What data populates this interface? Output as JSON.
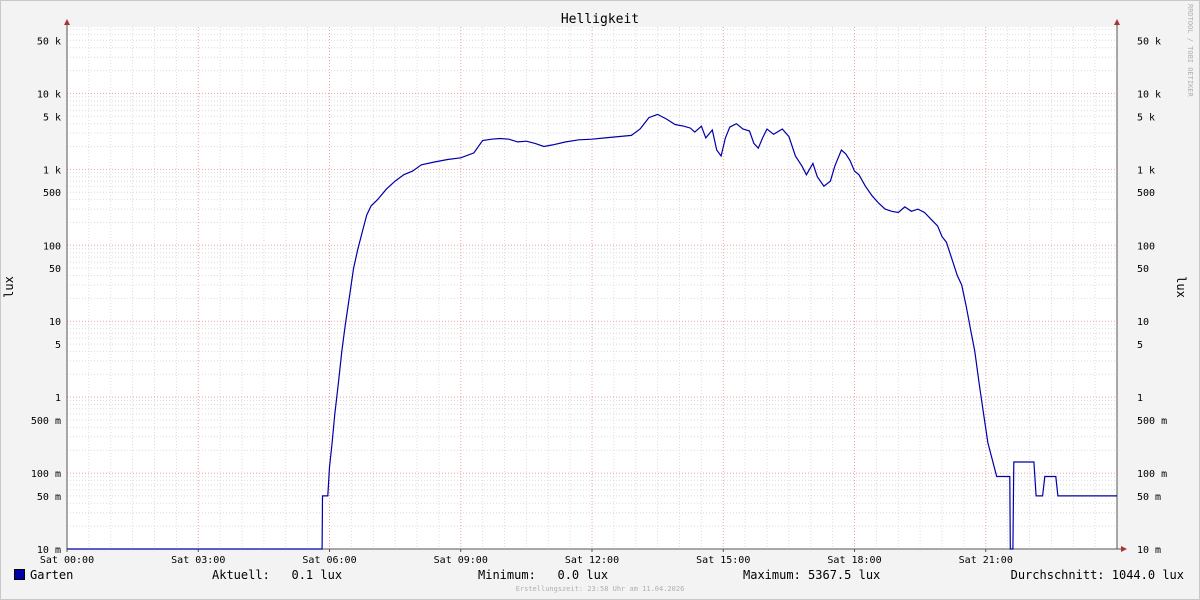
{
  "chart_data": {
    "type": "line",
    "title": "Helligkeit",
    "ylabel": "lux",
    "yscale": "log",
    "ylim": [
      0.01,
      75000
    ],
    "xlim": [
      0,
      24
    ],
    "grid": true,
    "x_tick_labels": [
      {
        "x": 0,
        "label": "Sat 00:00"
      },
      {
        "x": 3,
        "label": "Sat 03:00"
      },
      {
        "x": 6,
        "label": "Sat 06:00"
      },
      {
        "x": 9,
        "label": "Sat 09:00"
      },
      {
        "x": 12,
        "label": "Sat 12:00"
      },
      {
        "x": 15,
        "label": "Sat 15:00"
      },
      {
        "x": 18,
        "label": "Sat 18:00"
      },
      {
        "x": 21,
        "label": "Sat 21:00"
      }
    ],
    "y_tick_labels": [
      {
        "y": 50000,
        "label": "50 k"
      },
      {
        "y": 10000,
        "label": "10 k"
      },
      {
        "y": 5000,
        "label": "5 k"
      },
      {
        "y": 1000,
        "label": "1 k"
      },
      {
        "y": 500,
        "label": "500"
      },
      {
        "y": 100,
        "label": "100"
      },
      {
        "y": 50,
        "label": "50"
      },
      {
        "y": 10,
        "label": "10"
      },
      {
        "y": 5,
        "label": "5"
      },
      {
        "y": 1,
        "label": "1"
      },
      {
        "y": 0.5,
        "label": "500 m"
      },
      {
        "y": 0.1,
        "label": "100 m"
      },
      {
        "y": 0.05,
        "label": "50 m"
      },
      {
        "y": 0.01,
        "label": "10 m"
      }
    ],
    "series": [
      {
        "name": "Garten",
        "color": "#0000aa",
        "points": [
          [
            0,
            0.01
          ],
          [
            5.83,
            0.01
          ],
          [
            5.84,
            0.05
          ],
          [
            5.96,
            0.05
          ],
          [
            6.0,
            0.12
          ],
          [
            6.06,
            0.25
          ],
          [
            6.12,
            0.6
          ],
          [
            6.2,
            1.5
          ],
          [
            6.28,
            4
          ],
          [
            6.36,
            9
          ],
          [
            6.45,
            20
          ],
          [
            6.55,
            50
          ],
          [
            6.65,
            90
          ],
          [
            6.75,
            150
          ],
          [
            6.85,
            250
          ],
          [
            6.95,
            330
          ],
          [
            7.1,
            400
          ],
          [
            7.3,
            550
          ],
          [
            7.5,
            700
          ],
          [
            7.7,
            850
          ],
          [
            7.9,
            950
          ],
          [
            8.1,
            1150
          ],
          [
            8.4,
            1250
          ],
          [
            8.7,
            1350
          ],
          [
            9.0,
            1420
          ],
          [
            9.3,
            1650
          ],
          [
            9.5,
            2400
          ],
          [
            9.7,
            2500
          ],
          [
            9.9,
            2550
          ],
          [
            10.1,
            2500
          ],
          [
            10.3,
            2300
          ],
          [
            10.5,
            2350
          ],
          [
            10.7,
            2200
          ],
          [
            10.9,
            2000
          ],
          [
            11.1,
            2100
          ],
          [
            11.4,
            2300
          ],
          [
            11.7,
            2450
          ],
          [
            12.0,
            2500
          ],
          [
            12.3,
            2600
          ],
          [
            12.6,
            2700
          ],
          [
            12.9,
            2800
          ],
          [
            13.1,
            3400
          ],
          [
            13.3,
            4800
          ],
          [
            13.5,
            5300
          ],
          [
            13.7,
            4600
          ],
          [
            13.9,
            3900
          ],
          [
            14.1,
            3700
          ],
          [
            14.25,
            3500
          ],
          [
            14.35,
            3100
          ],
          [
            14.5,
            3700
          ],
          [
            14.6,
            2600
          ],
          [
            14.75,
            3300
          ],
          [
            14.85,
            1800
          ],
          [
            14.95,
            1500
          ],
          [
            15.05,
            2600
          ],
          [
            15.15,
            3600
          ],
          [
            15.3,
            4000
          ],
          [
            15.45,
            3400
          ],
          [
            15.6,
            3200
          ],
          [
            15.7,
            2200
          ],
          [
            15.8,
            1900
          ],
          [
            15.9,
            2600
          ],
          [
            16.0,
            3400
          ],
          [
            16.15,
            2900
          ],
          [
            16.35,
            3400
          ],
          [
            16.5,
            2700
          ],
          [
            16.65,
            1500
          ],
          [
            16.8,
            1100
          ],
          [
            16.9,
            850
          ],
          [
            17.05,
            1200
          ],
          [
            17.15,
            800
          ],
          [
            17.3,
            600
          ],
          [
            17.45,
            700
          ],
          [
            17.55,
            1100
          ],
          [
            17.7,
            1800
          ],
          [
            17.8,
            1600
          ],
          [
            17.9,
            1300
          ],
          [
            18.0,
            950
          ],
          [
            18.1,
            850
          ],
          [
            18.25,
            600
          ],
          [
            18.4,
            450
          ],
          [
            18.55,
            360
          ],
          [
            18.7,
            300
          ],
          [
            18.85,
            280
          ],
          [
            19.0,
            270
          ],
          [
            19.15,
            320
          ],
          [
            19.3,
            280
          ],
          [
            19.45,
            300
          ],
          [
            19.6,
            270
          ],
          [
            19.75,
            220
          ],
          [
            19.9,
            180
          ],
          [
            20.0,
            130
          ],
          [
            20.1,
            110
          ],
          [
            20.25,
            60
          ],
          [
            20.35,
            40
          ],
          [
            20.45,
            30
          ],
          [
            20.55,
            16
          ],
          [
            20.65,
            8
          ],
          [
            20.75,
            4
          ],
          [
            20.85,
            1.5
          ],
          [
            20.95,
            0.6
          ],
          [
            21.05,
            0.25
          ],
          [
            21.15,
            0.15
          ],
          [
            21.25,
            0.09
          ],
          [
            21.55,
            0.09
          ],
          [
            21.56,
            0.01
          ],
          [
            21.62,
            0.01
          ],
          [
            21.64,
            0.14
          ],
          [
            21.7,
            0.14
          ],
          [
            22.1,
            0.14
          ],
          [
            22.15,
            0.05
          ],
          [
            22.3,
            0.05
          ],
          [
            22.35,
            0.09
          ],
          [
            22.6,
            0.09
          ],
          [
            22.65,
            0.05
          ],
          [
            24,
            0.05
          ]
        ]
      }
    ]
  },
  "legend": {
    "name": "Garten",
    "aktuell": "Aktuell:   0.1 lux",
    "minimum": "Minimum:   0.0 lux",
    "maximum": "Maximum: 5367.5 lux",
    "durchschnitt": "Durchschnitt: 1044.0 lux"
  },
  "footer": "Erstellungszeit: 23:58 Uhr am 11.04.2026",
  "watermark": "RRDTOOL / TOBI OETIKER",
  "colors": {
    "background": "#f3f3f3",
    "plot_background": "#ffffff",
    "minor_grid": "#dcdcdc",
    "major_grid": "#f0a0a0",
    "axis": "#555555",
    "arrow": "#aa3333",
    "series": "#0000aa"
  }
}
